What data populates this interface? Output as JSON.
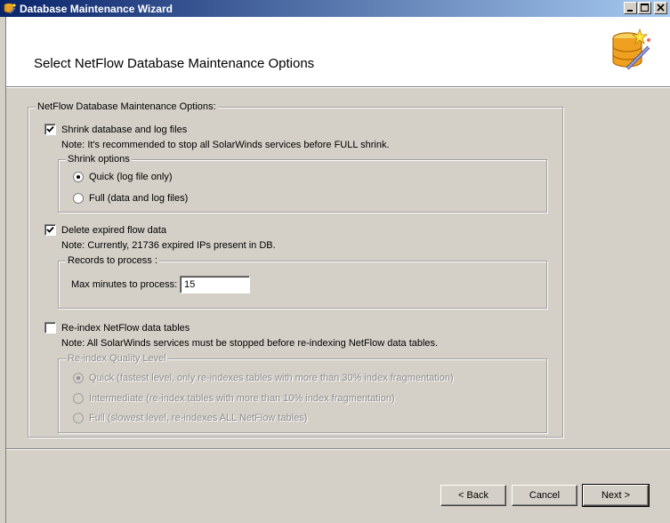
{
  "window": {
    "title": "Database Maintenance Wizard",
    "controls": [
      "minimize-icon",
      "maximize-icon",
      "close-icon"
    ]
  },
  "header": {
    "title": "Select NetFlow Database Maintenance Options",
    "icon": "database-wizard-icon"
  },
  "options": {
    "group_label": "NetFlow Database Maintenance Options:",
    "shrink": {
      "checked": true,
      "label": "Shrink database and log files",
      "note": "Note: It's recommended to stop all SolarWinds services before FULL shrink.",
      "group_label": "Shrink options",
      "choices": [
        {
          "label": "Quick (log file only)",
          "selected": true
        },
        {
          "label": "Full (data and log files)",
          "selected": false
        }
      ]
    },
    "delete_expired": {
      "checked": true,
      "label": "Delete expired flow data",
      "note": "Note: Currently, 21736 expired IPs present in DB.",
      "group_label": "Records to process :",
      "max_minutes_label": "Max minutes to process:",
      "max_minutes_value": "15"
    },
    "reindex": {
      "checked": false,
      "label": "Re-index NetFlow data tables",
      "note": "Note: All SolarWinds services must be stopped before re-indexing NetFlow data tables.",
      "group_label": "Re-index Quality Level",
      "choices": [
        {
          "label": "Quick (fastest level, only re-indexes tables with more than 30% index fragmentation)",
          "selected": true
        },
        {
          "label": "Intermediate (re-index tables with more than 10% index fragmentation)",
          "selected": false
        },
        {
          "label": "Full (slowest level, re-indexes ALL NetFlow tables)",
          "selected": false
        }
      ]
    }
  },
  "buttons": {
    "back": "< Back",
    "cancel": "Cancel",
    "next": "Next >"
  }
}
